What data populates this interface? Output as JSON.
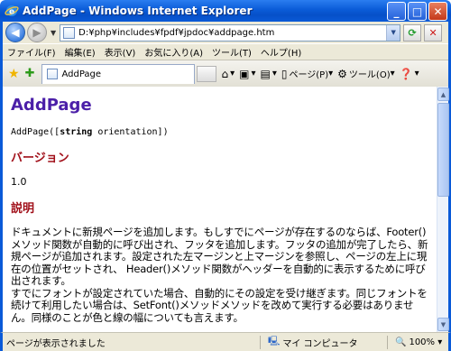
{
  "window": {
    "title": "AddPage - Windows Internet Explorer",
    "minimize": "_",
    "maximize": "□",
    "close": "✕"
  },
  "address_bar": {
    "url": "D:¥php¥includes¥fpdf¥jpdoc¥addpage.htm"
  },
  "menu": {
    "items": [
      "ファイル(F)",
      "編集(E)",
      "表示(V)",
      "お気に入り(A)",
      "ツール(T)",
      "ヘルプ(H)"
    ]
  },
  "tab": {
    "label": "AddPage"
  },
  "command_bar": {
    "page": "ページ(P)",
    "tools": "ツール(O)"
  },
  "document": {
    "heading": "AddPage",
    "signature_prefix": "AddPage([",
    "signature_type": "string",
    "signature_suffix": " orientation])",
    "version_heading": "バージョン",
    "version": "1.0",
    "description_heading": "説明",
    "description_p1": "ドキュメントに新規ページを追加します。もしすでにページが存在するのならば、Footer()メソッド関数が自動的に呼び出され、フッタを追加します。フッタの追加が完了したら、新規ページが追加されます。設定された左マージンと上マージンを参照し、ページの左上に現在の位置がセットされ、 Header()メソッド関数がヘッダーを自動的に表示するために呼び出されます。",
    "description_p2": "すでにフォントが設定されていた場合、自動的にその設定を受け継ぎます。同じフォントを続けて利用したい場合は、SetFont()メソッドメソッドを改めて実行する必要はありません。同様のことが色と線の幅についても言えます。"
  },
  "status_bar": {
    "text": "ページが表示されました",
    "zone": "マイ コンピュータ",
    "zoom": "100%"
  },
  "colors": {
    "heading": "#4b1fa8",
    "subheading": "#a1101a",
    "titlebar": "#0a5ad8"
  }
}
